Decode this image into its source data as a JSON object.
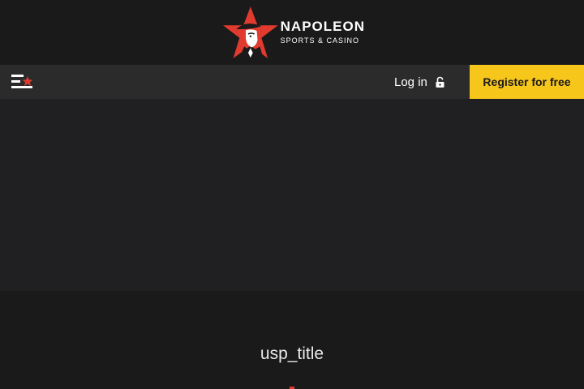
{
  "header": {
    "logo": {
      "brand": "NAPOLEON",
      "subtitle": "SPORTS & CASINO",
      "icon": "napoleon-star-logo",
      "star_color": "#e03b2e"
    }
  },
  "nav": {
    "menu_icon": "hamburger-star-icon",
    "login_label": "Log in",
    "login_icon": "lock-icon",
    "register_label": "Register for free",
    "register_color": "#f6c61b"
  },
  "usp": {
    "title": "usp_title"
  }
}
